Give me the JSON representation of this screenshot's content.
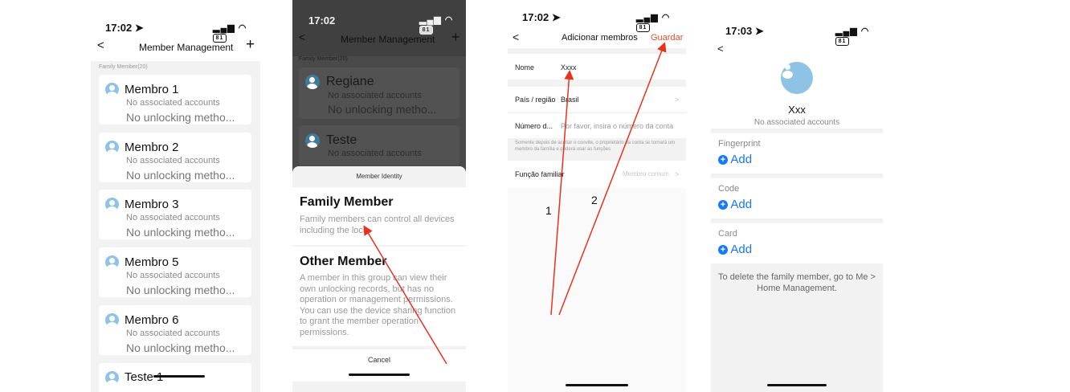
{
  "s1": {
    "time": "17:02 ➤",
    "signal": "▂▄▆ ◠",
    "battery": "81",
    "back": "<",
    "title": "Member Management",
    "plus": "+",
    "section": "Family Member(20)",
    "members": [
      {
        "name": "Membro 1",
        "acc": "No associated accounts",
        "lock": "No unlocking metho..."
      },
      {
        "name": "Membro 2",
        "acc": "No associated accounts",
        "lock": "No unlocking metho..."
      },
      {
        "name": "Membro 3",
        "acc": "No associated accounts",
        "lock": "No unlocking metho..."
      },
      {
        "name": "Membro 5",
        "acc": "No associated accounts",
        "lock": "No unlocking metho..."
      },
      {
        "name": "Membro 6",
        "acc": "No associated accounts",
        "lock": "No unlocking metho..."
      }
    ],
    "partial": "Teste 1"
  },
  "s2": {
    "time": "17:02",
    "signal": "▂▄▆ ◠",
    "battery": "81",
    "back": "<",
    "title": "Member Management",
    "plus": "+",
    "section": "Family Member(20)",
    "m1_name": "Regiane",
    "m1_acc": "No associated accounts",
    "m1_lock": "No unlocking metho...",
    "m2_name": "Teste",
    "m2_acc": "No associated accounts",
    "sheet_title": "Member Identity",
    "fm_title": "Family Member",
    "fm_desc": "Family members can control all devices including the lock.",
    "om_title": "Other Member",
    "om_desc": "A member in this group can view their own unlocking records, but has no operation or management permissions. You can use the device sharing function to grant the member operation permissions.",
    "cancel": "Cancel"
  },
  "s3": {
    "time": "17:02 ➤",
    "signal": "▂▄▆ ◠",
    "battery": "81",
    "back": "<",
    "title": "Adicionar membros",
    "save": "Guardar",
    "name_label": "Nome",
    "name_value": "Xxxx",
    "country_label": "País / região",
    "country_value": "Brasil",
    "chevron": ">",
    "number_label": "Número d...",
    "number_placeholder": "Por favor, insira o número da conta",
    "note": "Somente depois de aceitar o convite, o proprietário da conta se tornará um membro da família e poderá usar as funções",
    "role_label": "Função familiar",
    "role_value": "Membro comum",
    "ann1": "1",
    "ann2": "2",
    "annotation_color": "#e8321e"
  },
  "s4": {
    "time": "17:03 ➤",
    "signal": "▂▄▆ ◠",
    "battery": "81",
    "back": "<",
    "name": "Xxx",
    "acc": "No associated accounts",
    "fingerprint": "Fingerprint",
    "code": "Code",
    "card": "Card",
    "add": "Add",
    "note": "To delete the family member, go to Me > Home Management.",
    "accent": "#1677ff"
  }
}
